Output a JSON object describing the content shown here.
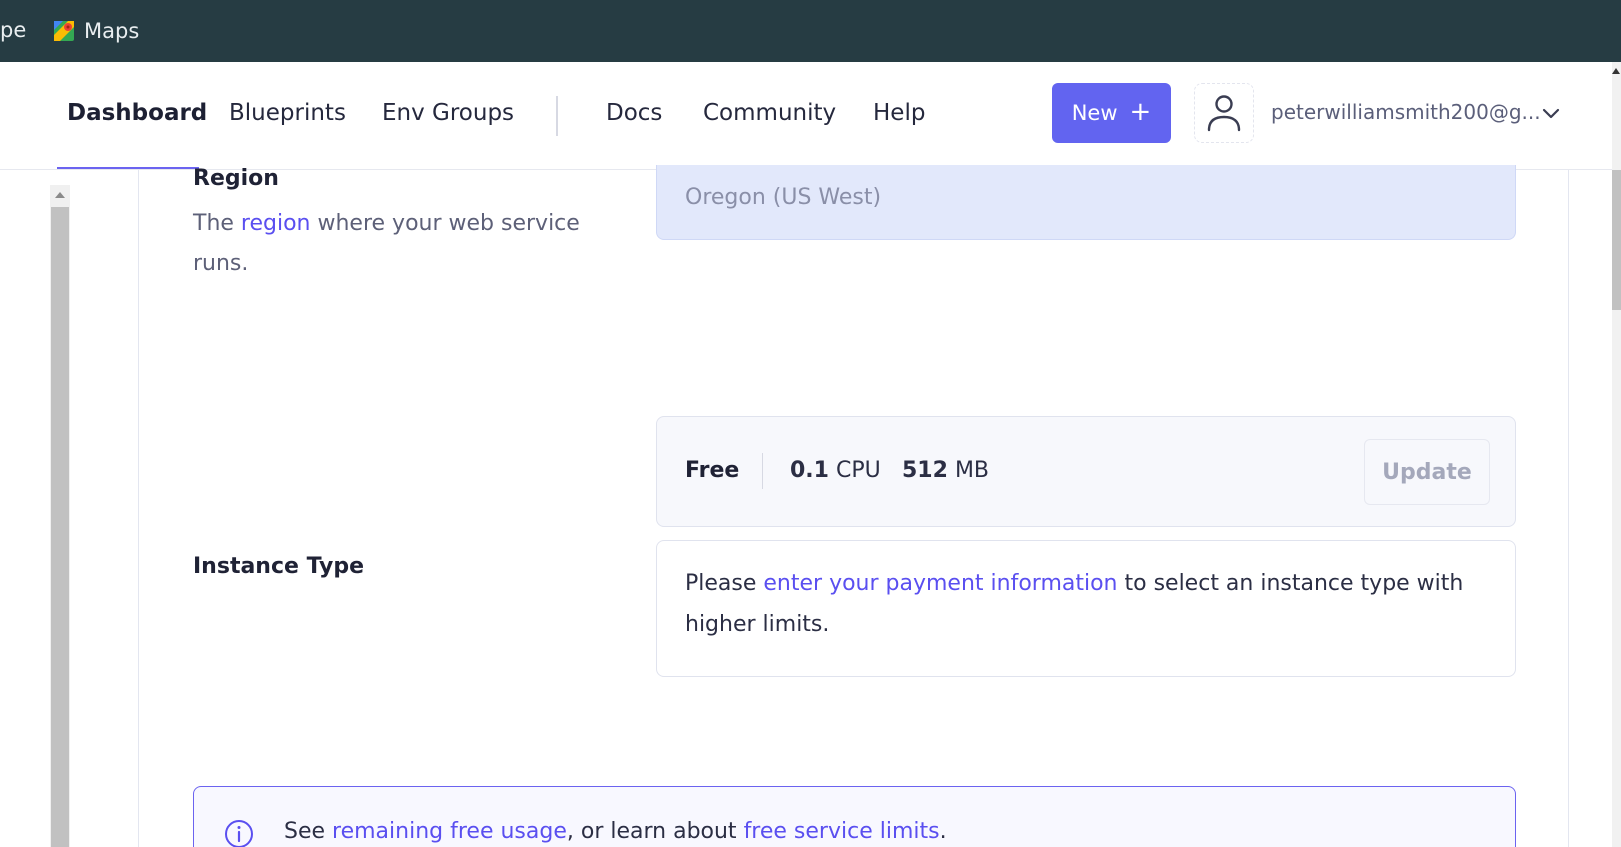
{
  "bookmarks": {
    "cut_item": "pe",
    "maps": "Maps"
  },
  "nav": {
    "items": [
      "Dashboard",
      "Blueprints",
      "Env Groups"
    ],
    "secondary": [
      "Docs",
      "Community",
      "Help"
    ],
    "new_button": "New",
    "user_email": "peterwilliamsmith200@g..."
  },
  "region": {
    "title": "Region",
    "desc_prefix": "The ",
    "desc_link": "region",
    "desc_suffix": " where your web service runs.",
    "value": "Oregon (US West)"
  },
  "instance": {
    "label": "Instance Type",
    "plan_name": "Free",
    "cpu_value": "0.1",
    "cpu_unit": "CPU",
    "mem_value": "512",
    "mem_unit": "MB",
    "update_button": "Update",
    "payment_prefix": "Please ",
    "payment_link": "enter your payment information",
    "payment_suffix": " to select an instance type with higher limits."
  },
  "info": {
    "prefix": "See ",
    "link1": "remaining free usage",
    "middle": ", or learn about ",
    "link2": "free service limits",
    "suffix": "."
  },
  "colors": {
    "accent": "#6264f0",
    "link": "#5a4ff0",
    "bookmarks_bg": "#263c43",
    "region_bg": "#e2e8fb"
  }
}
